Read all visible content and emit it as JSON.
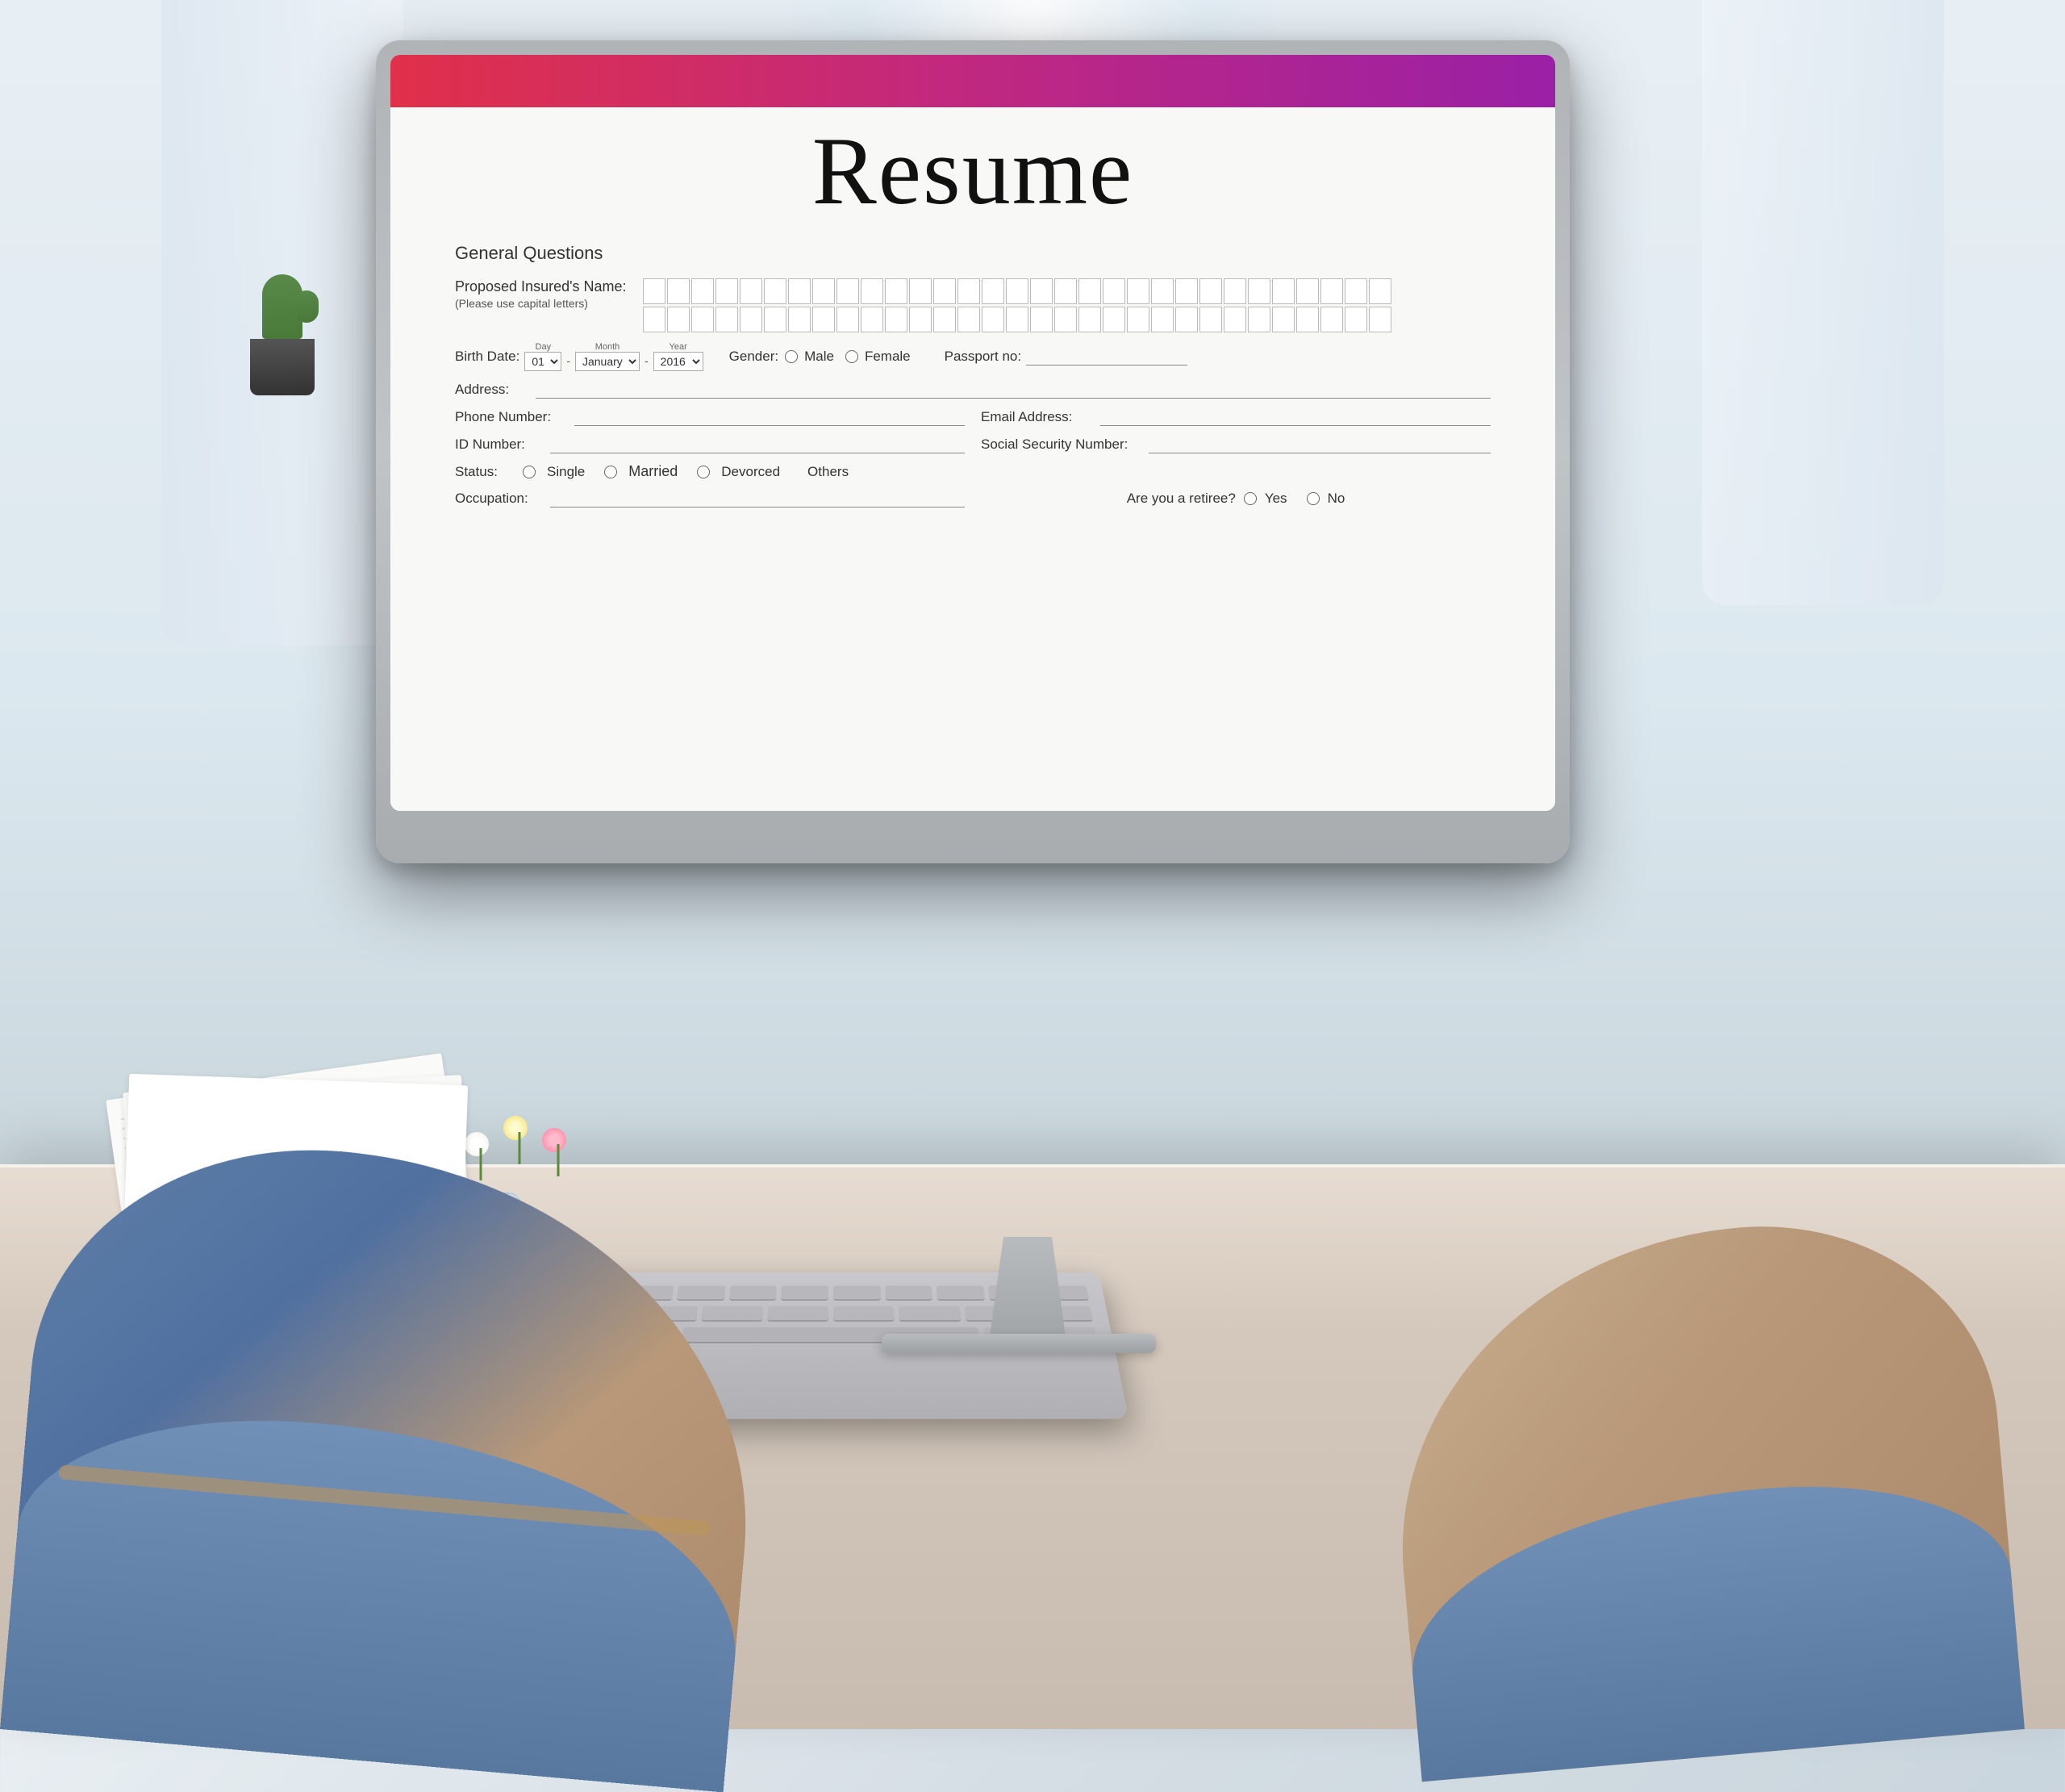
{
  "scene": {
    "background": "office desk with monitor"
  },
  "monitor": {
    "screen_header_gradient_start": "#e8304a",
    "screen_header_gradient_end": "#9b1fa8"
  },
  "resume_form": {
    "title": "Resume",
    "section": "General Questions",
    "fields": {
      "insured_name_label": "Proposed Insured's Name:",
      "insured_name_sublabel": "(Please use capital letters)",
      "birth_date_label": "Birth Date:",
      "birth_day": "01",
      "birth_month": "January",
      "birth_year": "2016",
      "gender_label": "Gender:",
      "gender_male": "Male",
      "gender_female": "Female",
      "passport_label": "Passport no:",
      "address_label": "Address:",
      "phone_label": "Phone Number:",
      "email_label": "Email Address:",
      "id_label": "ID Number:",
      "social_security_label": "Social Security  Number:",
      "status_label": "Status:",
      "status_single": "Single",
      "status_married": "Married",
      "status_divorced": "Devorced",
      "status_others": "Others",
      "occupation_label": "Occupation:",
      "retiree_label": "Are you a retiree?",
      "retiree_yes": "Yes",
      "retiree_no": "No"
    }
  }
}
